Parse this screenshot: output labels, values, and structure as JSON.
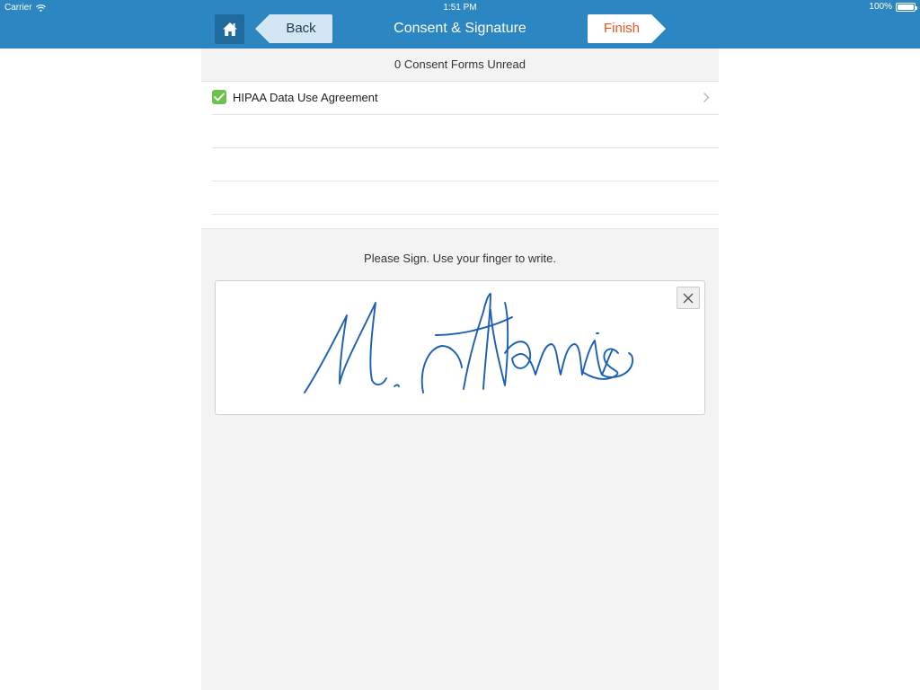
{
  "status_bar": {
    "carrier": "Carrier",
    "time": "1:51 PM",
    "battery": "100%",
    "icons": [
      "wifi-icon",
      "battery-icon"
    ]
  },
  "nav": {
    "home_icon": "home-icon",
    "back_label": "Back",
    "title": "Consent & Signature",
    "finish_label": "Finish"
  },
  "consent": {
    "unread_text": "0 Consent Forms Unread",
    "forms": [
      {
        "label": "HIPAA Data Use Agreement",
        "checked": true,
        "icon": "checkmark-icon"
      }
    ]
  },
  "signature": {
    "prompt": "Please Sign. Use your finger to write.",
    "clear_icon": "close-icon",
    "ink_color": "#1b5fb5",
    "signature_image": "handwritten signature"
  },
  "colors": {
    "header_blue": "#2b86c1",
    "home_button": "#1f6a9a",
    "back_button": "#d3e6f4",
    "finish_text": "#e8561f",
    "check_green": "#6cc24a",
    "panel_bg": "#f3f3f3"
  }
}
